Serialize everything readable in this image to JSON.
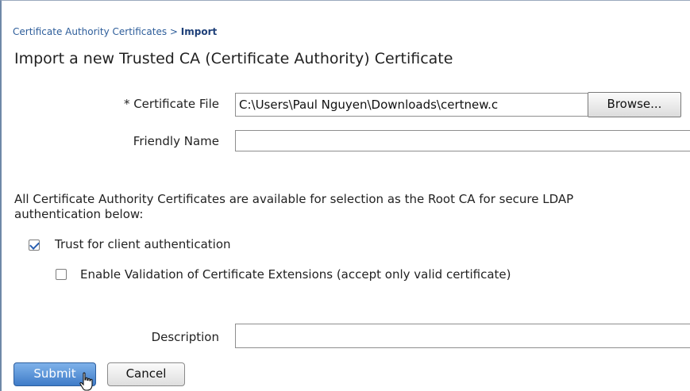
{
  "breadcrumb": {
    "parent": "Certificate Authority Certificates",
    "separator": " > ",
    "current": "Import"
  },
  "page_title": "Import a new Trusted CA (Certificate Authority) Certificate",
  "form": {
    "certificate_file": {
      "label": "* Certificate File",
      "value": "C:\\Users\\Paul Nguyen\\Downloads\\certnew.c",
      "browse_label": "Browse..."
    },
    "friendly_name": {
      "label": "Friendly Name",
      "value": ""
    },
    "info_text_line1": "All Certificate Authority Certificates are available for selection as the Root CA for secure LDAP",
    "info_text_line2": "authentication below:",
    "trust_client_auth": {
      "label": "Trust for client authentication",
      "checked": true
    },
    "enable_validation": {
      "label": "Enable Validation of Certificate Extensions (accept only valid certificate)",
      "checked": false
    },
    "description": {
      "label": "Description",
      "value": ""
    }
  },
  "buttons": {
    "submit_label": "Submit",
    "cancel_label": "Cancel"
  },
  "icons": {
    "cursor": "hand-pointer-icon",
    "checkmark": "checkmark-icon"
  },
  "colors": {
    "link": "#2d5d9a",
    "submit_top": "#7fb2ea",
    "submit_bottom": "#3f7cc8"
  }
}
